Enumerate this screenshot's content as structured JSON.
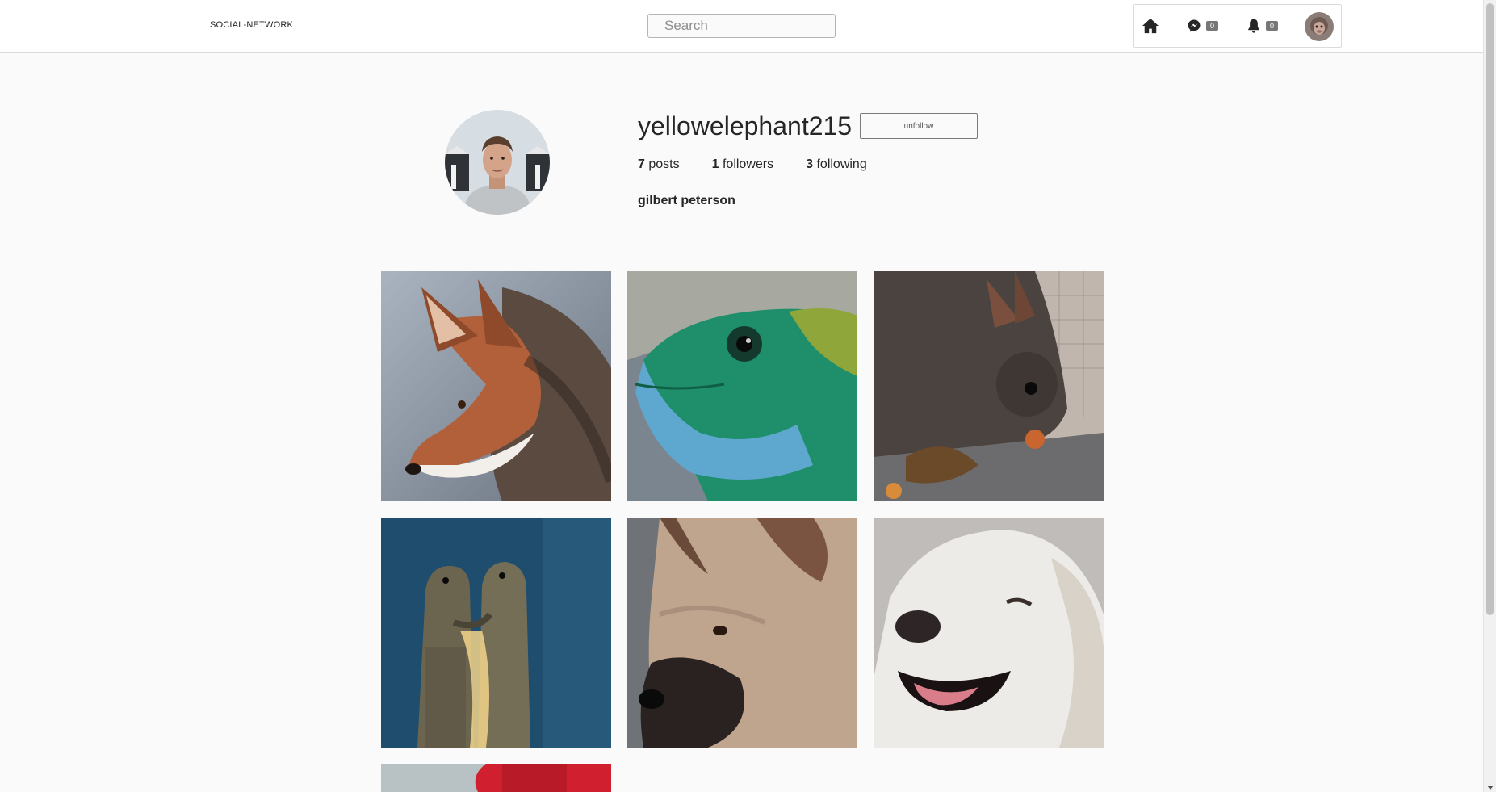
{
  "navbar": {
    "brand": "SOCIAL-NETWORK",
    "search_placeholder": "Search",
    "messages_count": "0",
    "notifications_count": "0",
    "icons": [
      "home-icon",
      "messenger-icon",
      "bell-icon"
    ]
  },
  "profile": {
    "username": "yellowelephant215",
    "unfollow_label": "unfollow",
    "posts_count": "7",
    "posts_label": "posts",
    "followers_count": "1",
    "followers_label": "followers",
    "following_count": "3",
    "following_label": "following",
    "full_name": "gilbert peterson"
  },
  "posts": [
    {
      "subject": "fox"
    },
    {
      "subject": "lizard"
    },
    {
      "subject": "squirrel"
    },
    {
      "subject": "meerkats"
    },
    {
      "subject": "puppy"
    },
    {
      "subject": "white-dog"
    },
    {
      "subject": "partial-photo"
    }
  ],
  "colors": {
    "background": "#fafafa",
    "border": "#dbdbdb",
    "text": "#262626",
    "badge": "#777777"
  }
}
